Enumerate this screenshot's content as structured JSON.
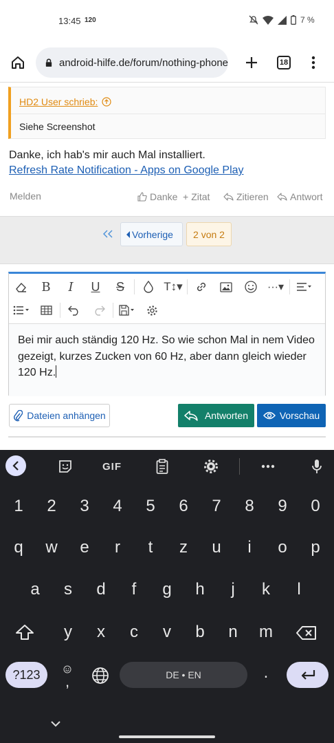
{
  "status": {
    "time": "13:45",
    "refresh": "120",
    "battery": "7 %"
  },
  "browser": {
    "url": "android-hilfe.de/forum/nothing-phone",
    "tabs": "18"
  },
  "quote": {
    "author": "HD2 User schrieb:",
    "text": "Siehe Screenshot"
  },
  "post": {
    "text": "Danke, ich hab's mir auch Mal installiert.",
    "link": "Refresh Rate Notification - Apps on Google Play"
  },
  "actions": {
    "report": "Melden",
    "like": "Danke",
    "quote": "Zitat",
    "reply_quote": "Zitieren",
    "reply": "Antwort"
  },
  "pagination": {
    "prev": "Vorherige",
    "current": "2 von 2"
  },
  "editor": {
    "text": "Bei mir auch ständig 120 Hz. So wie schon Mal in nem Video gezeigt, kurzes Zucken von 60 Hz, aber dann gleich wieder 120 Hz."
  },
  "buttons": {
    "attach": "Dateien anhängen",
    "reply": "Antworten",
    "preview": "Vorschau"
  },
  "keyboard": {
    "gif": "GIF",
    "numbers": [
      "1",
      "2",
      "3",
      "4",
      "5",
      "6",
      "7",
      "8",
      "9",
      "0"
    ],
    "row1": [
      "q",
      "w",
      "e",
      "r",
      "t",
      "z",
      "u",
      "i",
      "o",
      "p"
    ],
    "row2": [
      "a",
      "s",
      "d",
      "f",
      "g",
      "h",
      "j",
      "k",
      "l"
    ],
    "row3": [
      "y",
      "x",
      "c",
      "v",
      "b",
      "n",
      "m"
    ],
    "sym": "?123",
    "comma": ",",
    "period": ".",
    "space": "DE • EN"
  },
  "colors": {
    "accent": "#3a86d8",
    "reply": "#13806a",
    "preview": "#0f64b5",
    "quote_border": "#f0a020"
  }
}
